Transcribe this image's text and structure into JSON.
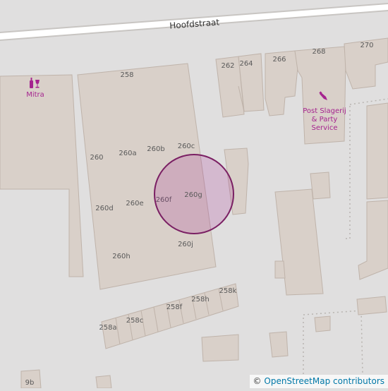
{
  "map": {
    "street_name": "Hoofdstraat",
    "background_color": "#e0dfdf",
    "building_color": "#d9d0c9",
    "road_color": "#ffffff",
    "marker_color": "#a5248f"
  },
  "pois": {
    "mitra": {
      "name": "Mitra",
      "icon": "wine-bottle-glass-icon"
    },
    "butcher": {
      "line1": "Post Slagerij",
      "line2": "& Party",
      "line3": "Service",
      "icon": "butcher-knife-icon"
    }
  },
  "house_numbers": {
    "n258": "258",
    "n260": "260",
    "n260a": "260a",
    "n260b": "260b",
    "n260c": "260c",
    "n260d": "260d",
    "n260e": "260e",
    "n260f": "260f",
    "n260g": "260g",
    "n260h": "260h",
    "n260j": "260j",
    "n262": "262",
    "n264": "264",
    "n266": "266",
    "n268": "268",
    "n270": "270",
    "n258k": "258k",
    "n258h": "258h",
    "n258f": "258f",
    "n258c": "258c",
    "n258a": "258a",
    "n9b": "9b"
  },
  "attribution": {
    "symbol": "©",
    "link_text": "OpenStreetMap contributors"
  }
}
